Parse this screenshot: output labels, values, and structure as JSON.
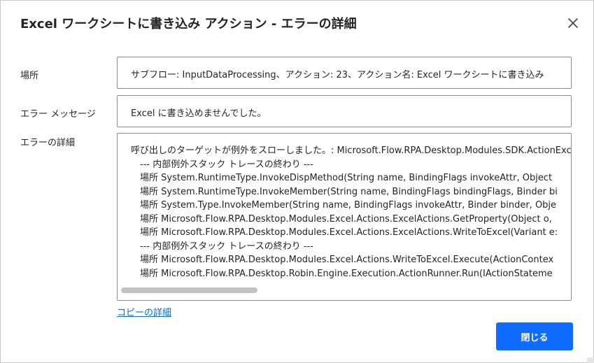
{
  "dialog": {
    "title": "Excel ワークシートに書き込み アクション - エラーの詳細",
    "close_icon": "close-icon"
  },
  "location": {
    "label": "場所",
    "value": "サブフロー: InputDataProcessing、アクション: 23、アクション名: Excel ワークシートに書き込み"
  },
  "message": {
    "label": "エラー メッセージ",
    "value": "Excel に書き込めませんでした。"
  },
  "details": {
    "label": "エラーの詳細",
    "lines": [
      {
        "text": "呼び出しのターゲットが例外をスローしました。: Microsoft.Flow.RPA.Desktop.Modules.SDK.ActionExce",
        "indent": false
      },
      {
        "text": "--- 内部例外スタック トレースの終わり ---",
        "indent": true
      },
      {
        "text": "場所 System.RuntimeType.InvokeDispMethod(String name, BindingFlags invokeAttr, Object",
        "indent": true
      },
      {
        "text": "場所 System.RuntimeType.InvokeMember(String name, BindingFlags bindingFlags, Binder bi",
        "indent": true
      },
      {
        "text": "場所 System.Type.InvokeMember(String name, BindingFlags invokeAttr, Binder binder, Obje",
        "indent": true
      },
      {
        "text": "場所 Microsoft.Flow.RPA.Desktop.Modules.Excel.Actions.ExcelActions.GetProperty(Object o,",
        "indent": true
      },
      {
        "text": "場所 Microsoft.Flow.RPA.Desktop.Modules.Excel.Actions.ExcelActions.WriteToExcel(Variant e:",
        "indent": true
      },
      {
        "text": "--- 内部例外スタック トレースの終わり ---",
        "indent": true
      },
      {
        "text": "場所 Microsoft.Flow.RPA.Desktop.Modules.Excel.Actions.WriteToExcel.Execute(ActionContex",
        "indent": true
      },
      {
        "text": "場所 Microsoft.Flow.RPA.Desktop.Robin.Engine.Execution.ActionRunner.Run(IActionStateme",
        "indent": true
      }
    ]
  },
  "actions": {
    "copy_details": "コピーの詳細",
    "close_button": "閉じる"
  },
  "colors": {
    "accent": "#0f6cff",
    "link": "#0f6cbd"
  }
}
